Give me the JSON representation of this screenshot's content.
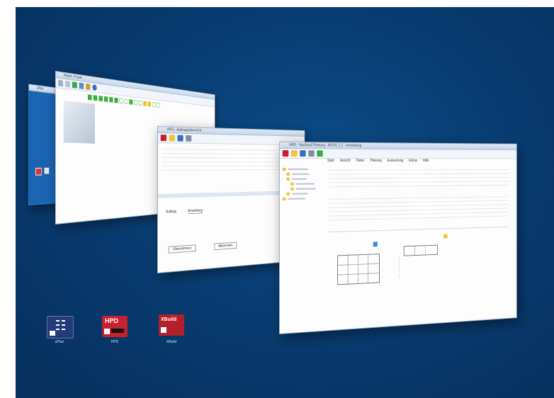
{
  "windows": {
    "front": {
      "title": "HPD - Nachlauf Planung - MOVE 1.2 - Verwaltung",
      "tabs": [
        "Start",
        "Ansicht",
        "Daten",
        "Planung",
        "Auswertung",
        "Extras",
        "Hilfe"
      ]
    },
    "middle": {
      "title": "HPD - Auftragsübersicht",
      "field_label": "Auftrag",
      "field_value": "Bestellung",
      "buttons": [
        "Übernehmen",
        "Abbrechen"
      ]
    },
    "back": {
      "title": "XBuild - Projekt"
    },
    "far": {
      "title": "uPlan"
    }
  },
  "desktop_icons": [
    {
      "name": "uPlan",
      "badge": ""
    },
    {
      "name": "HPD",
      "badge": "HPD"
    },
    {
      "name": "XBuild",
      "badge": "XBuild"
    }
  ],
  "colors": {
    "desktop": "#083a6e",
    "accent": "#c8202f",
    "folder": "#f2c23a",
    "status_green": "#3cae3c"
  }
}
